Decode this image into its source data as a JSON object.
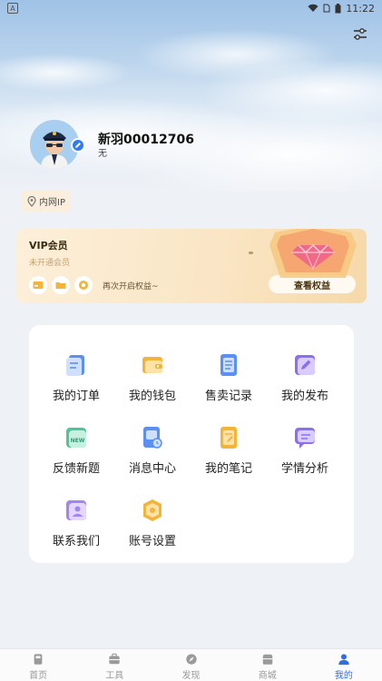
{
  "status_bar": {
    "app_badge": "A",
    "time": "11:22"
  },
  "profile": {
    "username": "新羽00012706",
    "subtitle": "无"
  },
  "ip_chip": {
    "label": "内网IP"
  },
  "vip": {
    "title": "VIP会员",
    "subtitle": "未开通会员",
    "hint": "再次开启权益~",
    "button": "查看权益"
  },
  "menu": {
    "items": [
      {
        "label": "我的订单",
        "icon": "order-icon",
        "color": "#5b8ff0"
      },
      {
        "label": "我的钱包",
        "icon": "wallet-icon",
        "color": "#f3b43a"
      },
      {
        "label": "售卖记录",
        "icon": "sales-record-icon",
        "color": "#5b8ff0"
      },
      {
        "label": "我的发布",
        "icon": "publish-icon",
        "color": "#8d6ef0"
      },
      {
        "label": "反馈新题",
        "icon": "feedback-new-icon",
        "color": "#4cc59a"
      },
      {
        "label": "消息中心",
        "icon": "message-center-icon",
        "color": "#5b8ff0"
      },
      {
        "label": "我的笔记",
        "icon": "notes-icon",
        "color": "#f3b43a"
      },
      {
        "label": "学情分析",
        "icon": "analysis-icon",
        "color": "#8d6ef0"
      },
      {
        "label": "联系我们",
        "icon": "contact-icon",
        "color": "#a584f0"
      },
      {
        "label": "账号设置",
        "icon": "account-settings-icon",
        "color": "#f3b43a"
      }
    ]
  },
  "tabs": [
    {
      "label": "首页",
      "icon": "home-icon"
    },
    {
      "label": "工具",
      "icon": "tools-icon"
    },
    {
      "label": "发现",
      "icon": "discover-icon"
    },
    {
      "label": "商城",
      "icon": "shop-icon"
    },
    {
      "label": "我的",
      "icon": "profile-icon",
      "active": true
    }
  ],
  "colors": {
    "accent": "#2f6fe6",
    "inactive": "#999999"
  }
}
